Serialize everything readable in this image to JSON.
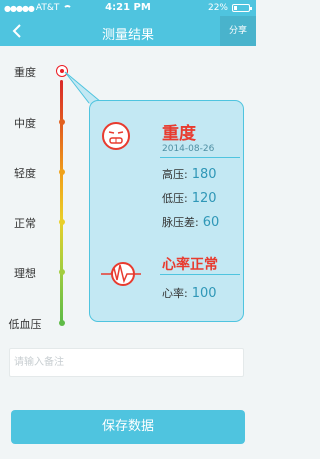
{
  "status_bar": {
    "carrier": "AT&T",
    "time": "4:21 PM",
    "battery_percent": "22%",
    "battery_level": 0.22
  },
  "nav": {
    "title": "测量结果",
    "share_label": "分享",
    "back_icon": "chevron-left-icon"
  },
  "levels": [
    {
      "label": "重度",
      "color": "#ec1c24",
      "active": true
    },
    {
      "label": "中度",
      "color": "#e2611f",
      "active": false
    },
    {
      "label": "轻度",
      "color": "#f0a21b",
      "active": false
    },
    {
      "label": "正常",
      "color": "#e9cf2a",
      "active": false
    },
    {
      "label": "理想",
      "color": "#a3cd3f",
      "active": false
    },
    {
      "label": "低血压",
      "color": "#5fbb47",
      "active": false
    }
  ],
  "result": {
    "severity": "重度",
    "date": "2014-08-26",
    "systolic_label": "高压:",
    "systolic_value": "180",
    "diastolic_label": "低压:",
    "diastolic_value": "120",
    "pulse_pressure_label": "脉压差:",
    "pulse_pressure_value": "60",
    "heart_rate_status": "心率正常",
    "heart_rate_label": "心率:",
    "heart_rate_value": "100"
  },
  "note": {
    "placeholder": "请输入备注",
    "value": ""
  },
  "save_label": "保存数据",
  "colors": {
    "accent": "#4fc4df",
    "alert": "#e83b2f",
    "card_bg": "#c3e8f3"
  }
}
